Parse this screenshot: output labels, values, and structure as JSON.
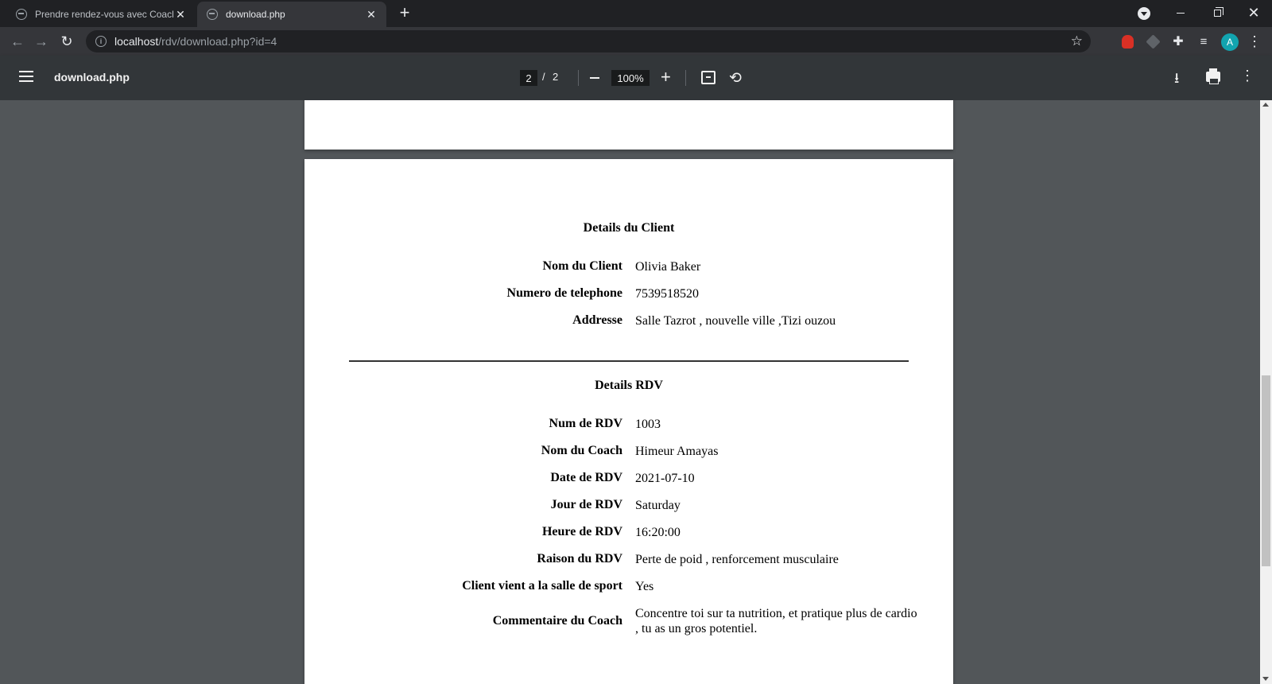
{
  "browser": {
    "tabs": [
      {
        "title": "Prendre rendez-vous avec Coach",
        "active": false
      },
      {
        "title": "download.php",
        "active": true
      }
    ],
    "address": {
      "host": "localhost",
      "path": "/rdv/download.php?id=4"
    },
    "profile_initial": "A"
  },
  "pdf_toolbar": {
    "title": "download.php",
    "current_page": "2",
    "page_separator": "/",
    "total_pages": "2",
    "zoom": "100%"
  },
  "document": {
    "client_section": {
      "title": "Details du Client",
      "rows": [
        {
          "label": "Nom du Client",
          "value": "Olivia Baker"
        },
        {
          "label": "Numero de telephone",
          "value": "7539518520"
        },
        {
          "label": "Addresse",
          "value": "Salle Tazrot , nouvelle ville ,Tizi ouzou"
        }
      ]
    },
    "rdv_section": {
      "title": "Details RDV",
      "rows": [
        {
          "label": "Num de RDV",
          "value": "1003"
        },
        {
          "label": "Nom du Coach",
          "value": "Himeur Amayas"
        },
        {
          "label": "Date de RDV",
          "value": "2021-07-10"
        },
        {
          "label": "Jour de RDV",
          "value": "Saturday"
        },
        {
          "label": "Heure de RDV",
          "value": "16:20:00"
        },
        {
          "label": "Raison du RDV",
          "value": "Perte de poid , renforcement musculaire"
        },
        {
          "label": "Client vient a la salle de sport",
          "value": "Yes"
        },
        {
          "label": "Commentaire du Coach",
          "value": "Concentre toi sur ta nutrition, et pratique plus de cardio , tu as un gros potentiel."
        }
      ]
    }
  },
  "icons": {
    "back": "arrow-left-icon",
    "forward": "arrow-right-icon",
    "reload": "reload-icon",
    "star": "star-icon",
    "menu": "hamburger-icon",
    "download": "download-icon",
    "print": "print-icon",
    "rotate": "rotate-icon",
    "fit": "fit-page-icon"
  },
  "colors": {
    "tabstrip": "#202124",
    "toolbar": "#35363a",
    "pdf_toolbar": "#323639",
    "viewer_bg": "#525659",
    "avatar": "#12a4af"
  }
}
